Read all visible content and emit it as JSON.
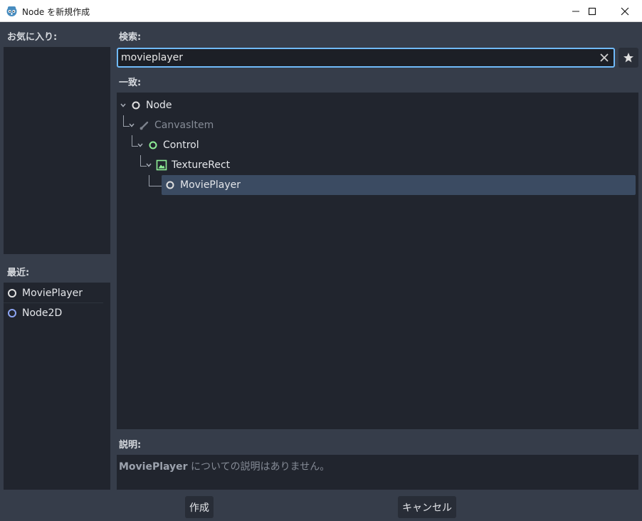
{
  "window": {
    "title": "Node を新規作成"
  },
  "favorites": {
    "label": "お気に入り:"
  },
  "recent": {
    "label": "最近:",
    "items": [
      {
        "label": "MoviePlayer",
        "icon": "node-icon",
        "color": "#e0e0e0"
      },
      {
        "label": "Node2D",
        "icon": "node2d-icon",
        "color": "#8da5f3"
      }
    ]
  },
  "search": {
    "label": "検索:",
    "value": "movieplayer"
  },
  "matches": {
    "label": "一致:",
    "tree": [
      {
        "label": "Node",
        "icon": "node-icon"
      },
      {
        "label": "CanvasItem",
        "icon": "brush-icon"
      },
      {
        "label": "Control",
        "icon": "control-icon"
      },
      {
        "label": "TextureRect",
        "icon": "texture-rect-icon"
      },
      {
        "label": "MoviePlayer",
        "icon": "node-icon",
        "selected": true
      }
    ]
  },
  "description": {
    "label": "説明:",
    "class_name": "MoviePlayer",
    "text": " についての説明はありません。"
  },
  "buttons": {
    "create": "作成",
    "cancel": "キャンセル"
  },
  "colors": {
    "accent": "#70bafa",
    "control_green": "#8eef97",
    "node2d_blue": "#8da5f3",
    "selection": "#3b4b62"
  }
}
